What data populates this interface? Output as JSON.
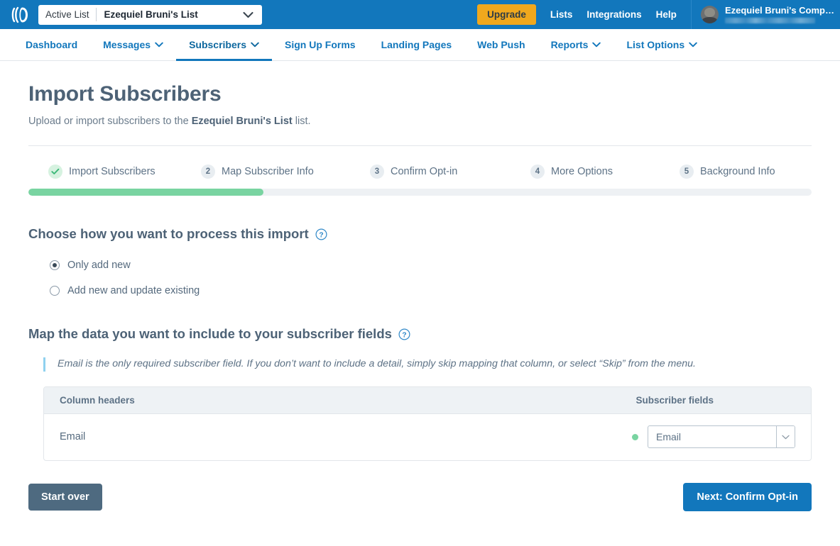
{
  "topbar": {
    "logo_icon": "sendpulse-logo-icon",
    "list_selector": {
      "label": "Active List",
      "value": "Ezequiel Bruni's List",
      "caret_icon": "chevron-down-icon"
    },
    "upgrade_label": "Upgrade",
    "links": [
      {
        "label": "Lists",
        "name": "lists"
      },
      {
        "label": "Integrations",
        "name": "integrations"
      },
      {
        "label": "Help",
        "name": "help"
      }
    ],
    "account": {
      "name": "Ezequiel Bruni's Comp…",
      "email_redacted": true,
      "avatar_icon": "user-avatar"
    }
  },
  "nav": {
    "items": [
      {
        "label": "Dashboard",
        "name": "dashboard",
        "caret": false,
        "active": false
      },
      {
        "label": "Messages",
        "name": "messages",
        "caret": true,
        "active": false
      },
      {
        "label": "Subscribers",
        "name": "subscribers",
        "caret": true,
        "active": true
      },
      {
        "label": "Sign Up Forms",
        "name": "sign-up-forms",
        "caret": false,
        "active": false
      },
      {
        "label": "Landing Pages",
        "name": "landing-pages",
        "caret": false,
        "active": false
      },
      {
        "label": "Web Push",
        "name": "web-push",
        "caret": false,
        "active": false
      },
      {
        "label": "Reports",
        "name": "reports",
        "caret": true,
        "active": false
      },
      {
        "label": "List Options",
        "name": "list-options",
        "caret": true,
        "active": false
      }
    ]
  },
  "page": {
    "title": "Import Subscribers",
    "subtitle_before": "Upload or import subscribers to the ",
    "subtitle_bold": "Ezequiel Bruni's List",
    "subtitle_after": " list."
  },
  "stepper": {
    "progress_percent": 30,
    "steps": [
      {
        "badge": "✓",
        "label": "Import Subscribers",
        "state": "done"
      },
      {
        "badge": "2",
        "label": "Map Subscriber Info",
        "state": "current"
      },
      {
        "badge": "3",
        "label": "Confirm Opt-in",
        "state": "upcoming"
      },
      {
        "badge": "4",
        "label": "More Options",
        "state": "upcoming"
      },
      {
        "badge": "5",
        "label": "Background Info",
        "state": "upcoming"
      }
    ]
  },
  "process_section": {
    "title": "Choose how you want to process this import",
    "help_icon": "help-circle-icon",
    "options": [
      {
        "label": "Only add new",
        "selected": true
      },
      {
        "label": "Add new and update existing",
        "selected": false
      }
    ]
  },
  "map_section": {
    "title": "Map the data you want to include to your subscriber fields",
    "help_icon": "help-circle-icon",
    "note": "Email is the only required subscriber field. If you don’t want to include a detail, simply skip mapping that column, or select “Skip” from the menu.",
    "table": {
      "headers": {
        "column_headers": "Column headers",
        "subscriber_fields": "Subscriber fields"
      },
      "rows": [
        {
          "column_header": "Email",
          "status": "mapped",
          "selected_field": "Email",
          "arrow_icon": "caret-down-icon"
        }
      ]
    }
  },
  "footer": {
    "start_over_label": "Start over",
    "next_label": "Next: Confirm Opt-in"
  },
  "colors": {
    "brand_blue": "#1277bc",
    "upgrade_amber": "#f0a81d",
    "progress_green": "#79d4a1",
    "slate": "#4e6a80",
    "text": "#5d7286"
  }
}
